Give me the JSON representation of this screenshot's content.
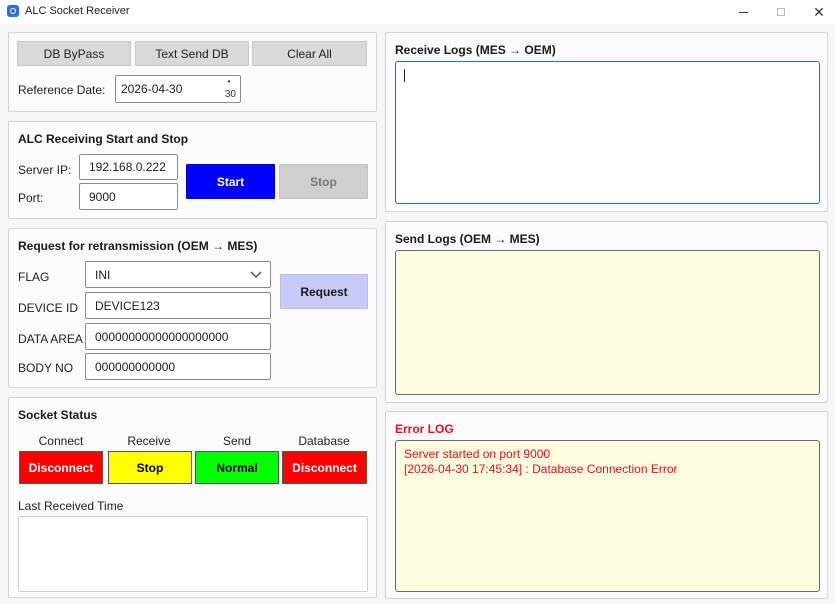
{
  "window": {
    "title": "ALC Socket Receiver"
  },
  "toolbar": {
    "db_bypass": "DB ByPass",
    "text_send_db": "Text Send DB",
    "clear_all": "Clear All",
    "reference_date_label": "Reference Date:",
    "reference_date_value": "2026-04-30",
    "date_spin_value": "30"
  },
  "alc": {
    "title": "ALC Receiving Start and Stop",
    "server_ip_label": "Server IP:",
    "server_ip_value": "192.168.0.222",
    "port_label": "Port:",
    "port_value": "9000",
    "start_label": "Start",
    "stop_label": "Stop"
  },
  "retransmission": {
    "title": "Request for retransmission (OEM → MES)",
    "flag_label": "FLAG",
    "flag_value": "INI",
    "device_id_label": "DEVICE ID",
    "device_id_value": "DEVICE123",
    "data_area_label": "DATA AREA",
    "data_area_value": "00000000000000000000",
    "body_no_label": "BODY NO",
    "body_no_value": "000000000000",
    "request_label": "Request"
  },
  "socket_status": {
    "title": "Socket Status",
    "columns": [
      {
        "header": "Connect",
        "state": "Disconnect",
        "color": "#ff0000",
        "text_color": "#ffffff"
      },
      {
        "header": "Receive",
        "state": "Stop",
        "color": "#ffff00",
        "text_color": "#000000"
      },
      {
        "header": "Send",
        "state": "Normal",
        "color": "#00ff00",
        "text_color": "#000000"
      },
      {
        "header": "Database",
        "state": "Disconnect",
        "color": "#ff0000",
        "text_color": "#ffffff"
      }
    ],
    "last_received_label": "Last Received Time"
  },
  "logs": {
    "receive_title": "Receive Logs (MES → OEM)",
    "send_title": "Send Logs (OEM → MES)",
    "error_title": "Error LOG",
    "error_lines": [
      "Server started on port 9000",
      "[2026-04-30 17:45:34] : Database Connection Error"
    ]
  },
  "colors": {
    "start_button": "#0000ff",
    "request_button": "#c7c9f7",
    "send_log_bg": "#fdfde0",
    "error_text": "#e81123",
    "receive_log_border": "#2f64c8"
  }
}
